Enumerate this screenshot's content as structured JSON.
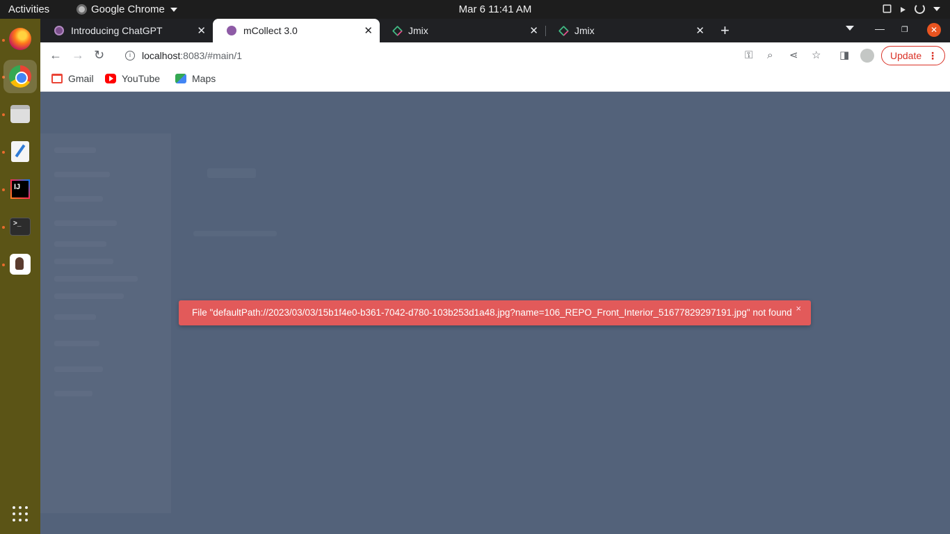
{
  "topbar": {
    "activities": "Activities",
    "app_name": "Google Chrome",
    "clock": "Mar 6  11:41 AM"
  },
  "dock": {
    "items": [
      "firefox-icon",
      "chrome-icon",
      "files-icon",
      "text-editor-icon",
      "intellij-icon",
      "terminal-icon",
      "pgadmin-icon",
      "show-apps-icon"
    ]
  },
  "tabs": [
    {
      "title": "Introducing ChatGPT",
      "active": false
    },
    {
      "title": "mCollect 3.0",
      "active": true
    },
    {
      "title": "Jmix",
      "active": false
    },
    {
      "title": "Jmix",
      "active": false
    }
  ],
  "toolbar": {
    "url_host": "localhost",
    "url_path": ":8083/#main/1",
    "update_label": "Update"
  },
  "bookmarks": [
    {
      "label": "Gmail"
    },
    {
      "label": "YouTube"
    },
    {
      "label": "Maps"
    }
  ],
  "notification": {
    "message": "File \"defaultPath://2023/03/03/15b1f4e0-b361-7042-d780-103b253d1a48.jpg?name=106_REPO_Front_Interior_51677829297191.jpg\" not found",
    "close": "×",
    "color": "#e25a5a"
  }
}
